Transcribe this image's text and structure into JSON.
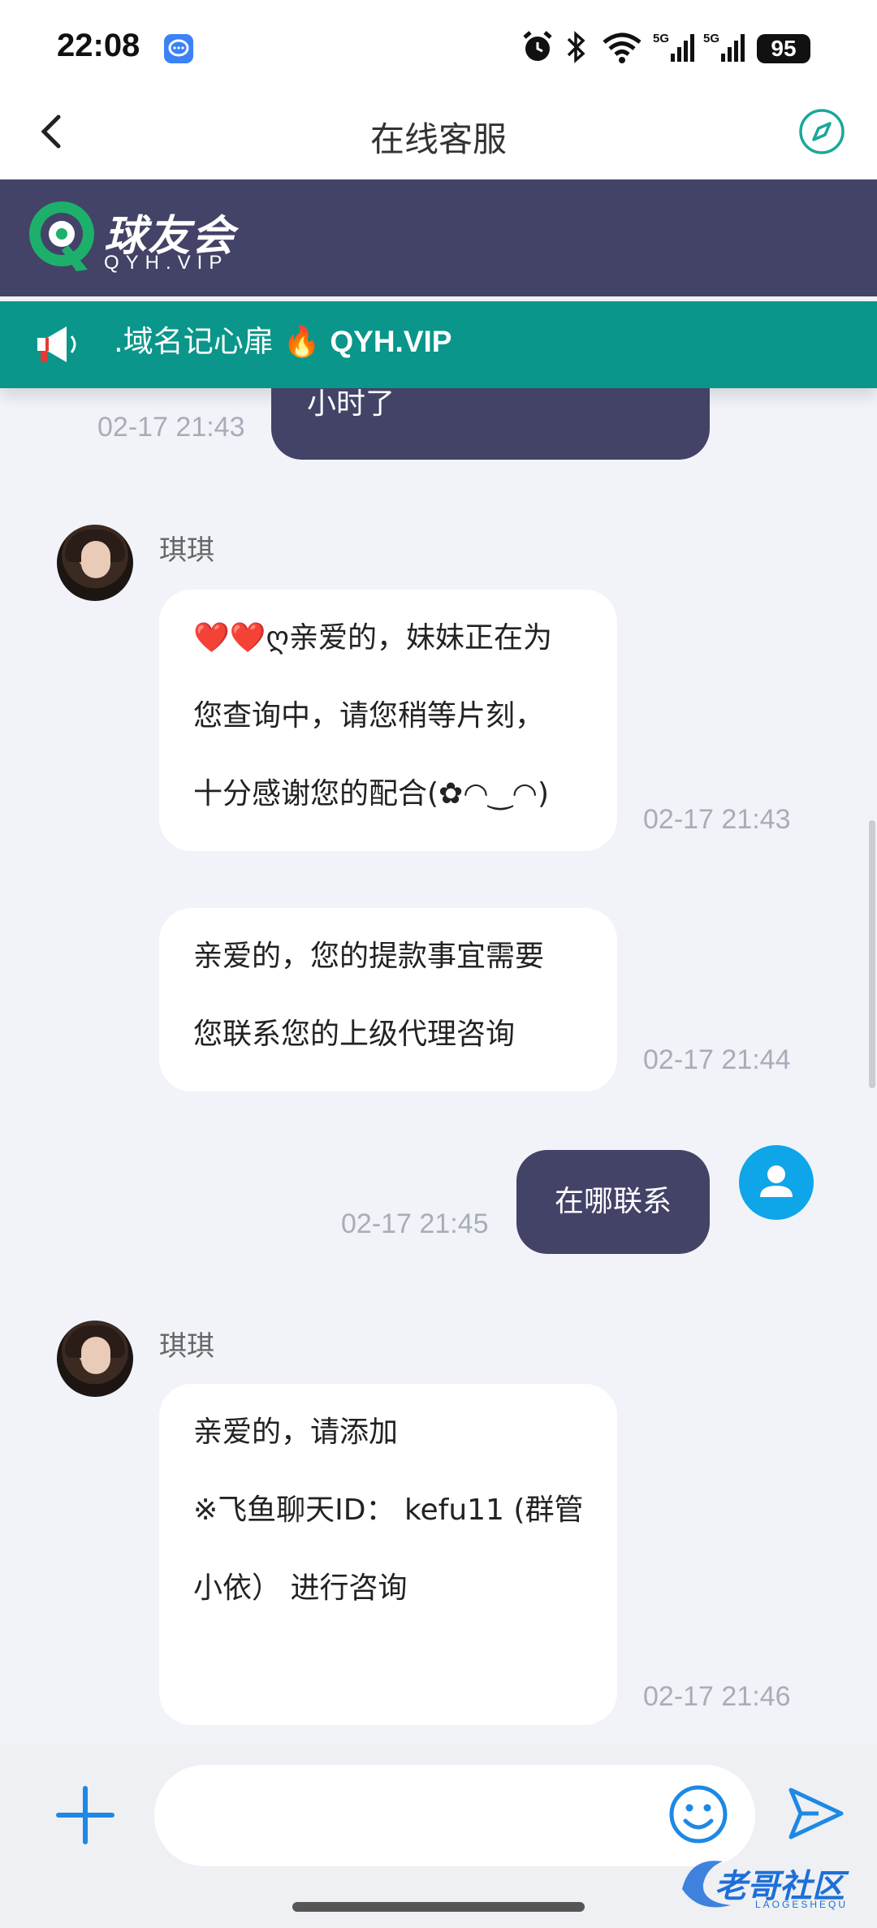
{
  "status_bar": {
    "time": "22:08",
    "battery": "95",
    "icons": [
      "message-app-icon",
      "alarm-icon",
      "bluetooth-icon",
      "wifi-icon",
      "signal-5g-icon",
      "signal-5g-icon",
      "battery-icon"
    ]
  },
  "nav": {
    "title": "在线客服",
    "back_icon": "chevron-left-icon",
    "right_icon": "compass-icon"
  },
  "brand": {
    "name_cn": "球友会",
    "name_en": "QYH.VIP",
    "bg_color": "#434267"
  },
  "notice": {
    "text": ".域名记心扉 🔥 ",
    "domain": "QYH.VIP",
    "icon": "megaphone-icon",
    "bg_color": "#0a968a"
  },
  "chat": {
    "messages": [
      {
        "sender": "user",
        "text": "小时了",
        "time": "02-17 21:43"
      },
      {
        "sender": "agent",
        "name": "琪琪",
        "lines": [
          "❤️❤️ღ亲爱的，妹妹正在为",
          "您查询中，请您稍等片刻，",
          "十分感谢您的配合(✿◠‿◠)"
        ],
        "time": "02-17 21:43"
      },
      {
        "sender": "agent",
        "lines": [
          "亲爱的，您的提款事宜需要",
          "您联系您的上级代理咨询"
        ],
        "time": "02-17 21:44"
      },
      {
        "sender": "user",
        "text": "在哪联系",
        "time": "02-17 21:45"
      },
      {
        "sender": "agent",
        "name": "琪琪",
        "lines": [
          "亲爱的，请添加",
          "※飞鱼聊天ID： kefu11 (群管",
          "小依） 进行咨询"
        ],
        "time": "02-17 21:46"
      }
    ]
  },
  "composer": {
    "placeholder": "",
    "plus_icon": "plus-icon",
    "emoji_icon": "smiley-icon",
    "send_icon": "send-icon"
  },
  "watermark": {
    "text": "老哥社区",
    "sub": "LAOGESHEQU"
  },
  "colors": {
    "accent": "#1e88e5",
    "user_bubble": "#434267",
    "timestamp": "#a7adb9"
  }
}
